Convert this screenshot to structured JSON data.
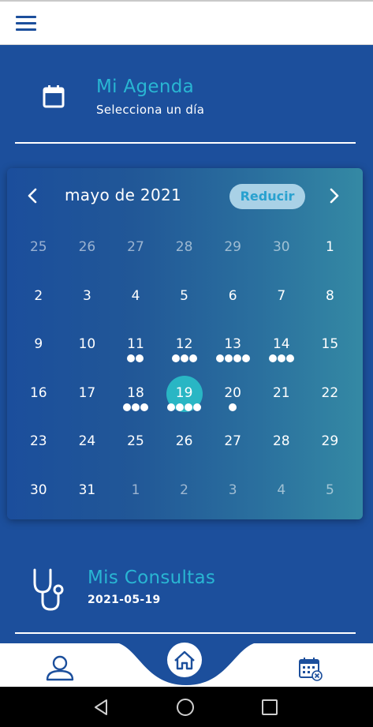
{
  "colors": {
    "accent": "#29b6d3",
    "bg": "#1c4f9c",
    "selected": "#29b6c4"
  },
  "menu_icon": "hamburger-menu-icon",
  "agenda": {
    "title": "Mi Agenda",
    "subtitle": "Selecciona un día",
    "icon": "calendar-icon"
  },
  "calendar": {
    "month_label": "mayo de 2021",
    "reduce_label": "Reducir",
    "weeks": [
      [
        {
          "d": "25",
          "o": true
        },
        {
          "d": "26",
          "o": true
        },
        {
          "d": "27",
          "o": true
        },
        {
          "d": "28",
          "o": true
        },
        {
          "d": "29",
          "o": true
        },
        {
          "d": "30",
          "o": true
        },
        {
          "d": "1"
        }
      ],
      [
        {
          "d": "2"
        },
        {
          "d": "3"
        },
        {
          "d": "4"
        },
        {
          "d": "5"
        },
        {
          "d": "6"
        },
        {
          "d": "7"
        },
        {
          "d": "8"
        }
      ],
      [
        {
          "d": "9"
        },
        {
          "d": "10"
        },
        {
          "d": "11",
          "dots": 2
        },
        {
          "d": "12",
          "dots": 3
        },
        {
          "d": "13",
          "dots": 4
        },
        {
          "d": "14",
          "dots": 3
        },
        {
          "d": "15"
        }
      ],
      [
        {
          "d": "16"
        },
        {
          "d": "17"
        },
        {
          "d": "18",
          "dots": 3
        },
        {
          "d": "19",
          "dots": 4,
          "sel": true
        },
        {
          "d": "20",
          "dots": 1
        },
        {
          "d": "21"
        },
        {
          "d": "22"
        }
      ],
      [
        {
          "d": "23"
        },
        {
          "d": "24"
        },
        {
          "d": "25"
        },
        {
          "d": "26"
        },
        {
          "d": "27"
        },
        {
          "d": "28"
        },
        {
          "d": "29"
        }
      ],
      [
        {
          "d": "30"
        },
        {
          "d": "31"
        },
        {
          "d": "1",
          "o": true
        },
        {
          "d": "2",
          "o": true
        },
        {
          "d": "3",
          "o": true
        },
        {
          "d": "4",
          "o": true
        },
        {
          "d": "5",
          "o": true
        }
      ]
    ]
  },
  "consultas": {
    "title": "Mis Consultas",
    "date": "2021-05-19",
    "icon": "stethoscope-icon"
  },
  "bottom_nav": {
    "profile": "user-icon",
    "home": "home-icon",
    "calendar": "calendar-cancel-icon"
  }
}
